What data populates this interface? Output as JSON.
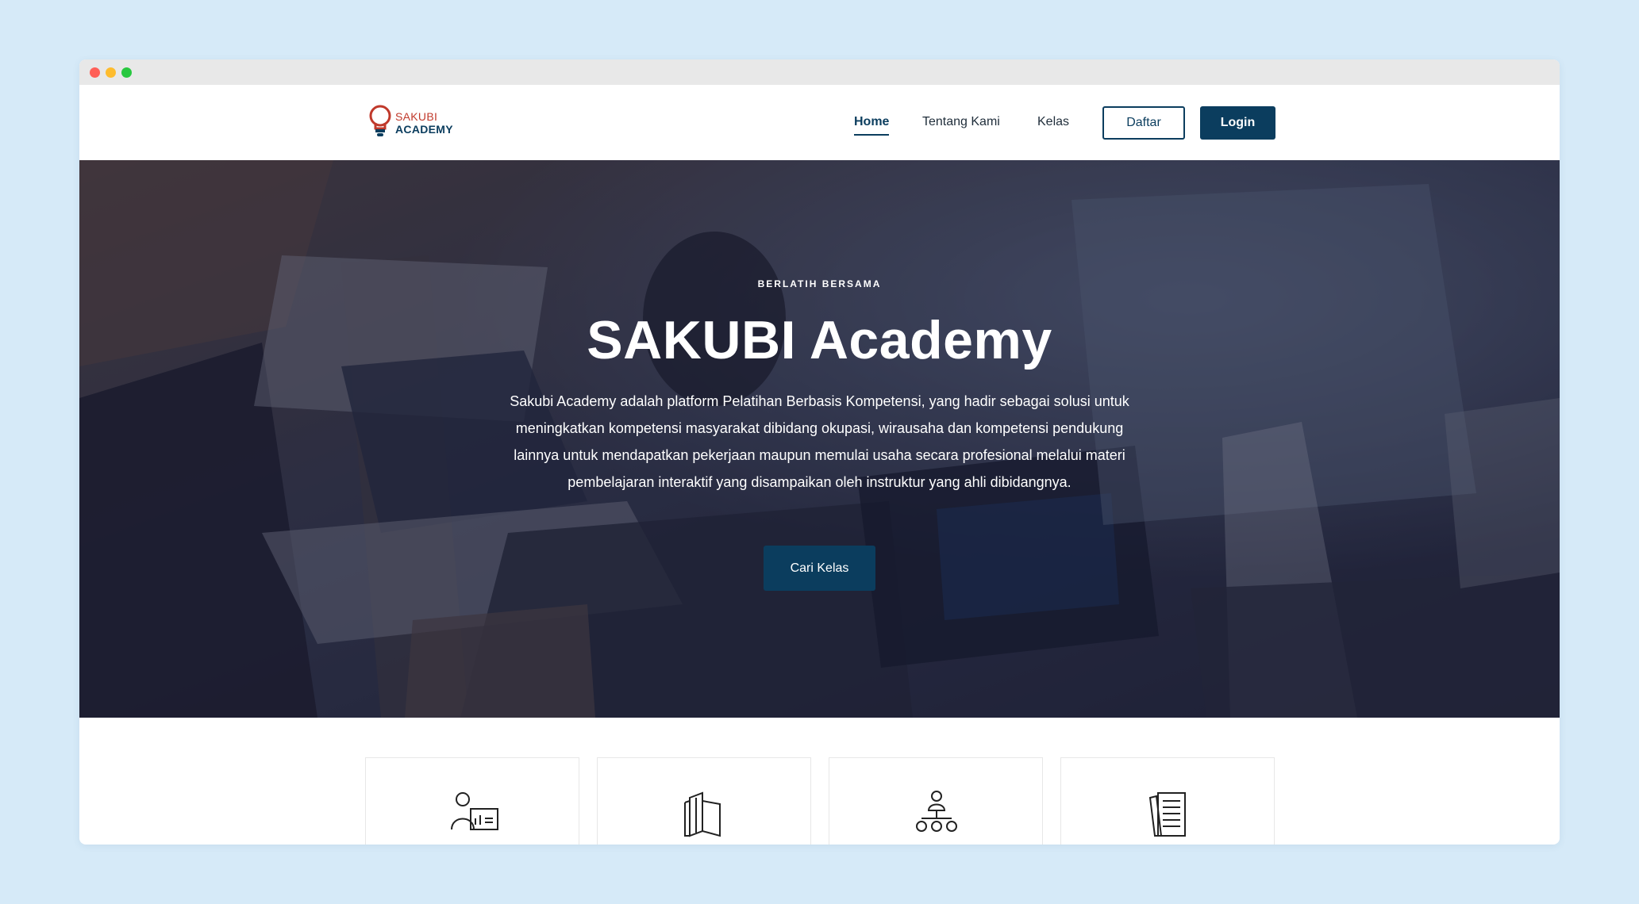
{
  "window": {
    "traffic_lights": [
      "close",
      "minimize",
      "maximize"
    ]
  },
  "brand": {
    "line1": "SAKUBI",
    "line2": "ACADEMY",
    "logo_icon": "lightbulb-icon",
    "colors": {
      "primary": "#0b3d5e",
      "accent": "#c0392b"
    }
  },
  "nav": {
    "items": [
      {
        "label": "Home",
        "active": true
      },
      {
        "label": "Tentang Kami",
        "active": false
      },
      {
        "label": "Kelas",
        "active": false
      }
    ],
    "register_label": "Daftar",
    "login_label": "Login"
  },
  "hero": {
    "eyebrow": "BERLATIH BERSAMA",
    "title": "SAKUBI Academy",
    "description": "Sakubi Academy adalah platform Pelatihan Berbasis Kompetensi, yang hadir sebagai solusi untuk meningkatkan kompetensi masyarakat dibidang okupasi, wirausaha dan kompetensi pendukung lainnya untuk mendapatkan pekerjaan maupun memulai usaha secara profesional melalui materi pembelajaran interaktif yang disampaikan oleh instruktur yang ahli dibidangnya.",
    "cta_label": "Cari Kelas"
  },
  "features": {
    "cards": [
      {
        "icon": "instructor-presentation-icon"
      },
      {
        "icon": "open-book-icon"
      },
      {
        "icon": "team-network-icon"
      },
      {
        "icon": "documents-icon"
      }
    ]
  }
}
